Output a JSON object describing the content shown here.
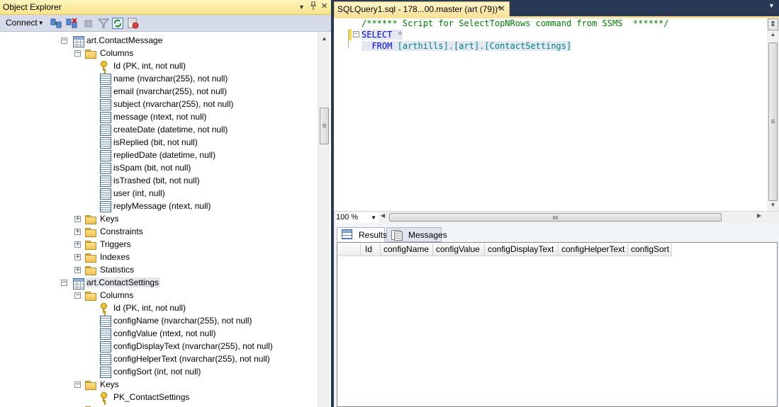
{
  "object_explorer": {
    "title": "Object Explorer",
    "pin_icon": "pin-icon",
    "menu_icon": "dropdown-arrow-icon",
    "close_label": "✕",
    "toolbar": {
      "connect_label": "Connect",
      "icons": [
        "connect-object-explorer-icon",
        "disconnect-icon",
        "stop-icon",
        "filter-icon",
        "refresh-icon",
        "activity-monitor-icon"
      ]
    },
    "tree": [
      {
        "label": "art.ContactMessage",
        "type": "table",
        "expanded": true
      },
      {
        "label": "Columns",
        "type": "folder",
        "expanded": true
      },
      {
        "label": "Id (PK, int, not null)",
        "type": "key"
      },
      {
        "label": "name (nvarchar(255), not null)",
        "type": "column"
      },
      {
        "label": "email (nvarchar(255), not null)",
        "type": "column"
      },
      {
        "label": "subject (nvarchar(255), not null)",
        "type": "column"
      },
      {
        "label": "message (ntext, not null)",
        "type": "column"
      },
      {
        "label": "createDate (datetime, not null)",
        "type": "column"
      },
      {
        "label": "isReplied (bit, not null)",
        "type": "column"
      },
      {
        "label": "repliedDate (datetime, null)",
        "type": "column"
      },
      {
        "label": "isSpam (bit, not null)",
        "type": "column"
      },
      {
        "label": "isTrashed (bit, not null)",
        "type": "column"
      },
      {
        "label": "user (int, null)",
        "type": "column"
      },
      {
        "label": "replyMessage (ntext, null)",
        "type": "column"
      },
      {
        "label": "Keys",
        "type": "folder",
        "expanded": false
      },
      {
        "label": "Constraints",
        "type": "folder",
        "expanded": false
      },
      {
        "label": "Triggers",
        "type": "folder",
        "expanded": false
      },
      {
        "label": "Indexes",
        "type": "folder",
        "expanded": false
      },
      {
        "label": "Statistics",
        "type": "folder",
        "expanded": false
      },
      {
        "label": "art.ContactSettings",
        "type": "table",
        "expanded": true,
        "selected": true
      },
      {
        "label": "Columns",
        "type": "folder",
        "expanded": true
      },
      {
        "label": "Id (PK, int, not null)",
        "type": "key"
      },
      {
        "label": "configName (nvarchar(255), not null)",
        "type": "column"
      },
      {
        "label": "configValue (ntext, not null)",
        "type": "column"
      },
      {
        "label": "configDisplayText (nvarchar(255), not null)",
        "type": "column"
      },
      {
        "label": "configHelperText (nvarchar(255), not null)",
        "type": "column"
      },
      {
        "label": "configSort (int, not null)",
        "type": "column"
      },
      {
        "label": "Keys",
        "type": "folder",
        "expanded": true
      },
      {
        "label": "PK_ContactSettings",
        "type": "key"
      }
    ]
  },
  "document": {
    "tab_title": "SQLQuery1.sql - 178...00.master (art (79))*",
    "tab_close": "✕",
    "code": {
      "line1": "/****** Script for SelectTopNRows command from SSMS  ******/",
      "line2_kw": "SELECT",
      "line2_op": " *",
      "line3_kw": "FROM",
      "line3_id": "[arthills].[art].[ContactSettings]"
    },
    "zoom": "100 %"
  },
  "results": {
    "tabs": [
      {
        "label": "Results",
        "icon": "results-grid-icon",
        "active": true
      },
      {
        "label": "Messages",
        "icon": "messages-icon",
        "active": false
      }
    ],
    "columns": [
      "Id",
      "configName",
      "configValue",
      "configDisplayText",
      "configHelperText",
      "configSort"
    ]
  },
  "colors": {
    "accent_tab": "#f8e29a",
    "keyword": "#0000ff",
    "comment": "#008000",
    "identifier": "#008080"
  }
}
